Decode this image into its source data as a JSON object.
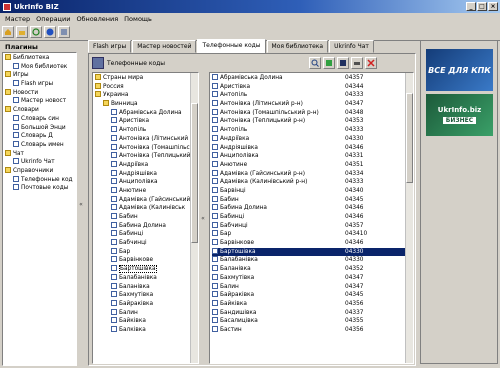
{
  "window": {
    "title": "UkrInfo BIZ",
    "min": "_",
    "max": "□",
    "close": "×"
  },
  "menu": [
    "Мастер",
    "Операции",
    "Обновления",
    "Помощь"
  ],
  "plugins": {
    "title": "Плагины",
    "items": [
      {
        "label": "Библиотека",
        "level": 0,
        "type": "folder"
      },
      {
        "label": "Моя библиотек",
        "level": 1,
        "type": "doc"
      },
      {
        "label": "Игры",
        "level": 0,
        "type": "folder"
      },
      {
        "label": "Flash игры",
        "level": 1,
        "type": "doc"
      },
      {
        "label": "Новости",
        "level": 0,
        "type": "folder"
      },
      {
        "label": "Мастер новост",
        "level": 1,
        "type": "doc"
      },
      {
        "label": "Словари",
        "level": 0,
        "type": "folder"
      },
      {
        "label": "Словарь син",
        "level": 1,
        "type": "doc"
      },
      {
        "label": "Большой Энци",
        "level": 1,
        "type": "doc"
      },
      {
        "label": "Словарь Д",
        "level": 1,
        "type": "doc"
      },
      {
        "label": "Словарь имен",
        "level": 1,
        "type": "doc"
      },
      {
        "label": "Чат",
        "level": 0,
        "type": "folder"
      },
      {
        "label": "Ukrinfo Чат",
        "level": 1,
        "type": "doc"
      },
      {
        "label": "Справочники",
        "level": 0,
        "type": "folder"
      },
      {
        "label": "Телефонные код",
        "level": 1,
        "type": "doc"
      },
      {
        "label": "Почтовые коды",
        "level": 1,
        "type": "doc"
      }
    ]
  },
  "tabs": [
    "Flash игры",
    "Мастер новостей",
    "Телефонные коды",
    "Моя библиотека",
    "Ukrinfo Чат"
  ],
  "active_tab": 2,
  "section_title": "Телефонные коды",
  "tree": [
    "Страны мира",
    "Россия",
    "Украина",
    "Винница",
    "Абрамівська Долина",
    "Аристівка",
    "Антопіль",
    "Антонівка (Літинський",
    "Антонівка (Томашпільськ",
    "Антонівка (Теплицький",
    "Андріївка",
    "Андріяшівка",
    "Анциполівка",
    "Анютине",
    "Адамівка (Гайсинський",
    "Адамівка (Калинівськ",
    "Бабин",
    "Бабина Долина",
    "Бабинці",
    "Бабчинці",
    "Бар",
    "Барвінкове",
    "Бартошівка",
    "Балабанівка",
    "Баланівка",
    "Бахмутівка",
    "Байраківка",
    "Балин",
    "Байківка",
    "Балківка"
  ],
  "tree_selected": "Бартошівка",
  "codes": [
    {
      "name": "Абрамівська Долина",
      "code": "04357"
    },
    {
      "name": "Аристівка",
      "code": "04344"
    },
    {
      "name": "Антопіль",
      "code": "04333"
    },
    {
      "name": "Антонівка (Літинський р-н)",
      "code": "04347"
    },
    {
      "name": "Антонівка (Томашпільський р-н)",
      "code": "04348"
    },
    {
      "name": "Антонівка (Теплицький р-н)",
      "code": "04353"
    },
    {
      "name": "Антопіль",
      "code": "04333"
    },
    {
      "name": "Андріївка",
      "code": "04330"
    },
    {
      "name": "Андріяшівка",
      "code": "04346"
    },
    {
      "name": "Анциполівка",
      "code": "04331"
    },
    {
      "name": "Анютине",
      "code": "04351"
    },
    {
      "name": "Адамівка (Гайсинський р-н)",
      "code": "04334"
    },
    {
      "name": "Адамівка (Калинівський р-н)",
      "code": "04333"
    },
    {
      "name": "Барвінці",
      "code": "04340"
    },
    {
      "name": "Бабин",
      "code": "04345"
    },
    {
      "name": "Бабина Долина",
      "code": "04346"
    },
    {
      "name": "Бабинці",
      "code": "04346"
    },
    {
      "name": "Бабчинці",
      "code": "04357"
    },
    {
      "name": "Бар",
      "code": "043410"
    },
    {
      "name": "Барвінкове",
      "code": "04346"
    },
    {
      "name": "Бартошівка",
      "code": "04330"
    },
    {
      "name": "Балабанівка",
      "code": "04330"
    },
    {
      "name": "Баланівка",
      "code": "04352"
    },
    {
      "name": "Бахмутівка",
      "code": "04347"
    },
    {
      "name": "Балин",
      "code": "04347"
    },
    {
      "name": "Байраківка",
      "code": "04345"
    },
    {
      "name": "Байківка",
      "code": "04356"
    },
    {
      "name": "Бандишівка",
      "code": "04337"
    },
    {
      "name": "Басалицівка",
      "code": "04355"
    },
    {
      "name": "Бастин",
      "code": "04356"
    }
  ],
  "codes_selected": "Бартошівка",
  "ads": [
    {
      "text": "ВСЕ ДЛЯ КПК"
    },
    {
      "text": "UkrInfo.biz",
      "sub": "БИЗНЕС"
    }
  ],
  "splitter": "«"
}
